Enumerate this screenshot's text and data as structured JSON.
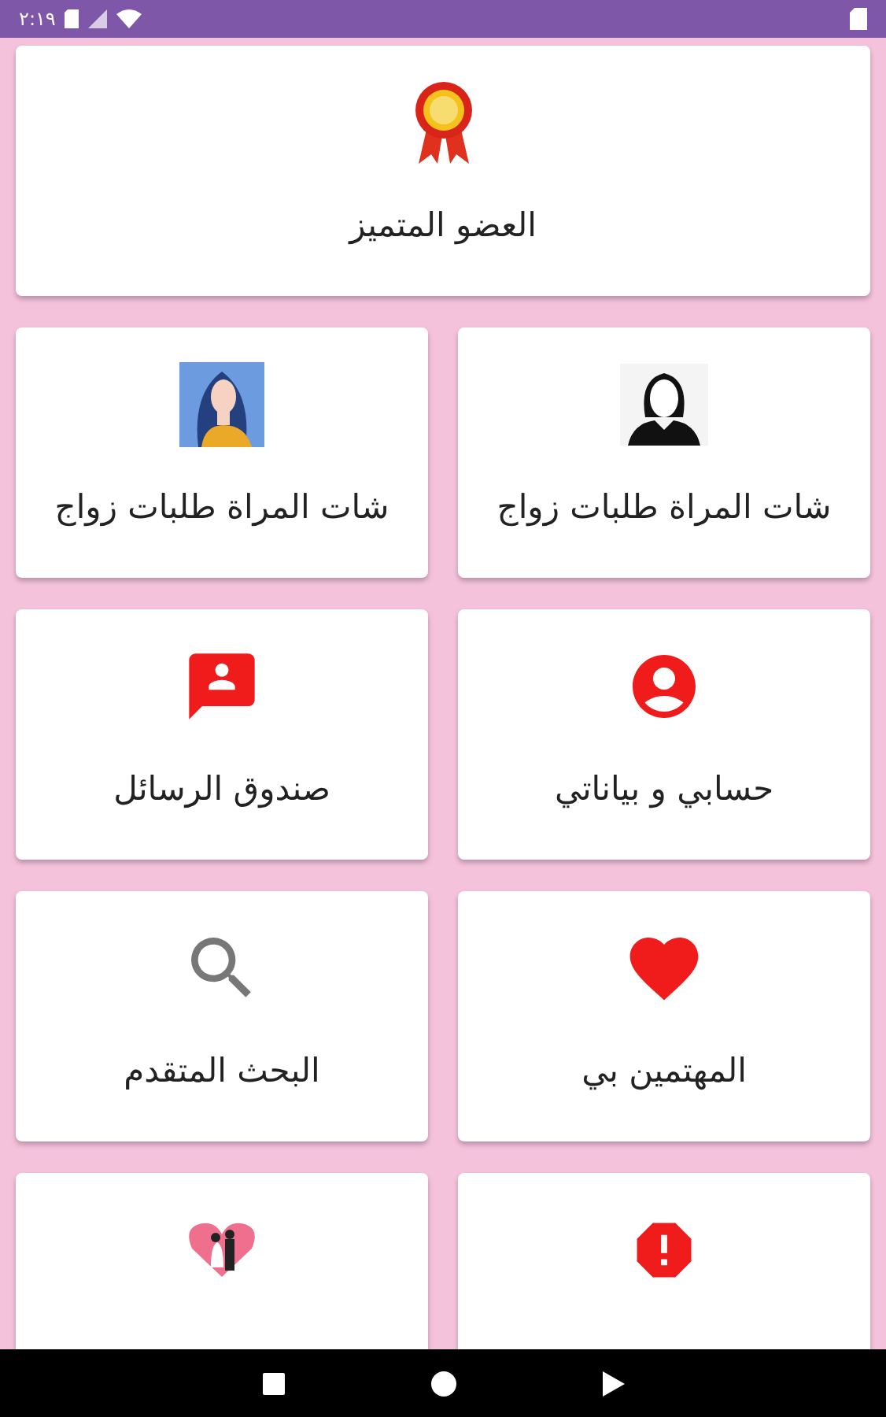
{
  "status_bar": {
    "time": "٢:١٩"
  },
  "featured": {
    "label": "العضو المتميز",
    "kind": "medal"
  },
  "tiles": [
    {
      "label": "شات المراة طلبات زواج",
      "kind": "silhouette"
    },
    {
      "label": "شات المراة طلبات زواج",
      "kind": "portrait"
    },
    {
      "label": "حسابي و بياناتي",
      "kind": "account"
    },
    {
      "label": "صندوق الرسائل",
      "kind": "message"
    },
    {
      "label": "المهتمين بي",
      "kind": "heart"
    },
    {
      "label": "البحث المتقدم",
      "kind": "search"
    },
    {
      "kind": "alert"
    },
    {
      "kind": "couple"
    }
  ]
}
